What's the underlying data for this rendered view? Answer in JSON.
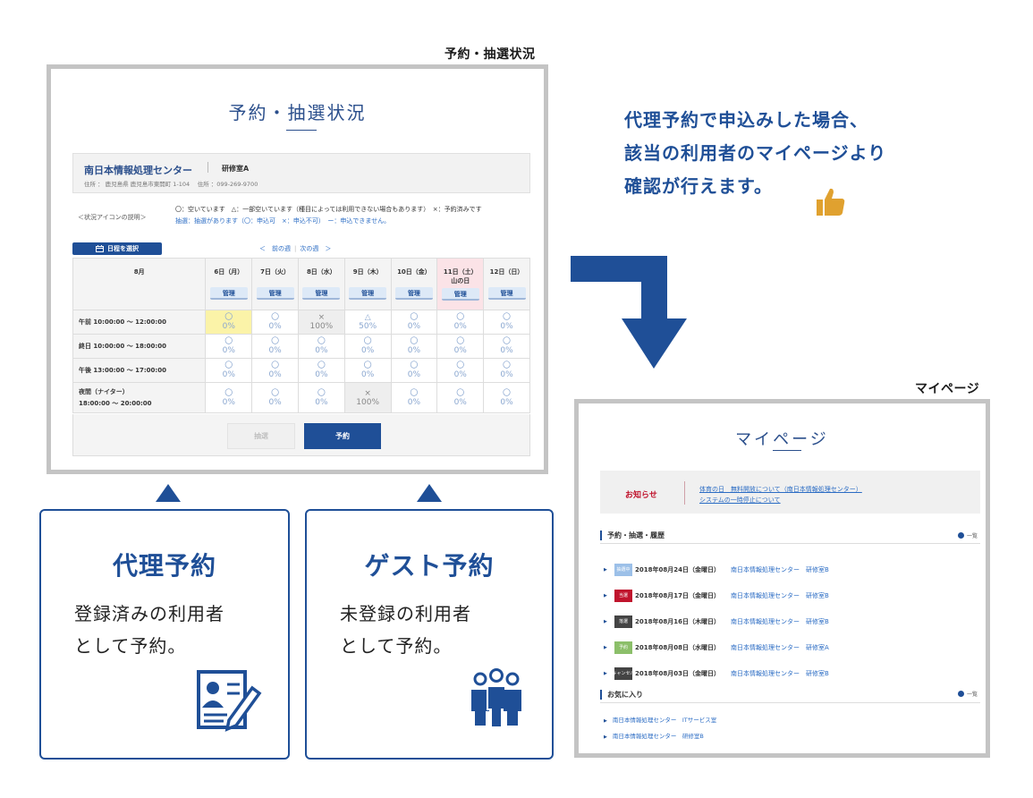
{
  "left_screen": {
    "caption": "予約・抽選状況",
    "title": "予約・抽選状況",
    "facility": {
      "name": "南日本情報処理センター",
      "room": "研修室A",
      "address": "住所 ： 鹿児島県 鹿児島市東開町 1-104　 住所 ：099-269-9700"
    },
    "legend": {
      "title": "＜状況アイコンの説明＞",
      "line1": "〇：空いています　△：一部空いています（種目によっては利用できない場合もあります）　×：予約済みです",
      "line2": "抽選：抽選があります（〇：申込可　×：申込不可）　ー：申込できません。"
    },
    "date_button": "日程を選択",
    "prev_week": "＜　前の週",
    "next_week": "次の週　＞",
    "month": "8月",
    "days": [
      {
        "label": "6日（月）",
        "holiday": ""
      },
      {
        "label": "7日（火）",
        "holiday": ""
      },
      {
        "label": "8日（水）",
        "holiday": ""
      },
      {
        "label": "9日（木）",
        "holiday": ""
      },
      {
        "label": "10日（金）",
        "holiday": ""
      },
      {
        "label": "11日（土）",
        "holiday": "山の日"
      },
      {
        "label": "12日（日）",
        "holiday": ""
      }
    ],
    "manage_label": "管理",
    "slots": [
      {
        "label": "午前 10:00:00 ～ 12:00:00",
        "label2": "",
        "cells": [
          [
            "〇",
            "0%"
          ],
          [
            "〇",
            "0%"
          ],
          [
            "×",
            "100%"
          ],
          [
            "△",
            "50%"
          ],
          [
            "〇",
            "0%"
          ],
          [
            "〇",
            "0%"
          ],
          [
            "〇",
            "0%"
          ]
        ]
      },
      {
        "label": "終日 10:00:00 ～ 18:00:00",
        "label2": "",
        "cells": [
          [
            "〇",
            "0%"
          ],
          [
            "〇",
            "0%"
          ],
          [
            "〇",
            "0%"
          ],
          [
            "〇",
            "0%"
          ],
          [
            "〇",
            "0%"
          ],
          [
            "〇",
            "0%"
          ],
          [
            "〇",
            "0%"
          ]
        ]
      },
      {
        "label": "午後 13:00:00 ～ 17:00:00",
        "label2": "",
        "cells": [
          [
            "〇",
            "0%"
          ],
          [
            "〇",
            "0%"
          ],
          [
            "〇",
            "0%"
          ],
          [
            "〇",
            "0%"
          ],
          [
            "〇",
            "0%"
          ],
          [
            "〇",
            "0%"
          ],
          [
            "〇",
            "0%"
          ]
        ]
      },
      {
        "label": "夜間（ナイター）",
        "label2": "18:00:00 ～ 20:00:00",
        "cells": [
          [
            "〇",
            "0%"
          ],
          [
            "〇",
            "0%"
          ],
          [
            "〇",
            "0%"
          ],
          [
            "×",
            "100%"
          ],
          [
            "〇",
            "0%"
          ],
          [
            "〇",
            "0%"
          ],
          [
            "〇",
            "0%"
          ]
        ]
      }
    ],
    "lottery_button": "抽選",
    "reserve_button": "予約"
  },
  "headline": {
    "line1": "代理予約で申込みした場合、",
    "line2": "該当の利用者のマイページより",
    "line3": "確認が行えます。"
  },
  "proxy_box": {
    "title": "代理予約",
    "desc1": "登録済みの利用者",
    "desc2": "として予約。"
  },
  "guest_box": {
    "title": "ゲスト予約",
    "desc1": "未登録の利用者",
    "desc2": "として予約。"
  },
  "mypage": {
    "caption": "マイページ",
    "title": "マイページ",
    "notice_label": "お知らせ",
    "notice_links": [
      "体育の日　無料開放について（南日本情報処理センター）",
      "システムの一時停止について"
    ],
    "history_heading": "予約・抽選・履歴",
    "list_link": "一覧",
    "history": [
      {
        "badge": "抽選中",
        "color": "#9cc0e8",
        "date": "2018年08月24日（金曜日）",
        "facility": "南日本情報処理センター　研修室B"
      },
      {
        "badge": "当選",
        "color": "#c0142d",
        "date": "2018年08月17日（金曜日）",
        "facility": "南日本情報処理センター　研修室B"
      },
      {
        "badge": "落選",
        "color": "#444444",
        "date": "2018年08月16日（木曜日）",
        "facility": "南日本情報処理センター　研修室B"
      },
      {
        "badge": "予約",
        "color": "#8cbf6a",
        "date": "2018年08月08日（水曜日）",
        "facility": "南日本情報処理センター　研修室A"
      },
      {
        "badge": "キャンセル",
        "color": "#444444",
        "date": "2018年08月03日（金曜日）",
        "facility": "南日本情報処理センター　研修室B"
      }
    ],
    "favorites_heading": "お気に入り",
    "favorites": [
      "南日本情報処理センター　ITサービス室",
      "南日本情報処理センター　研修室B"
    ]
  }
}
